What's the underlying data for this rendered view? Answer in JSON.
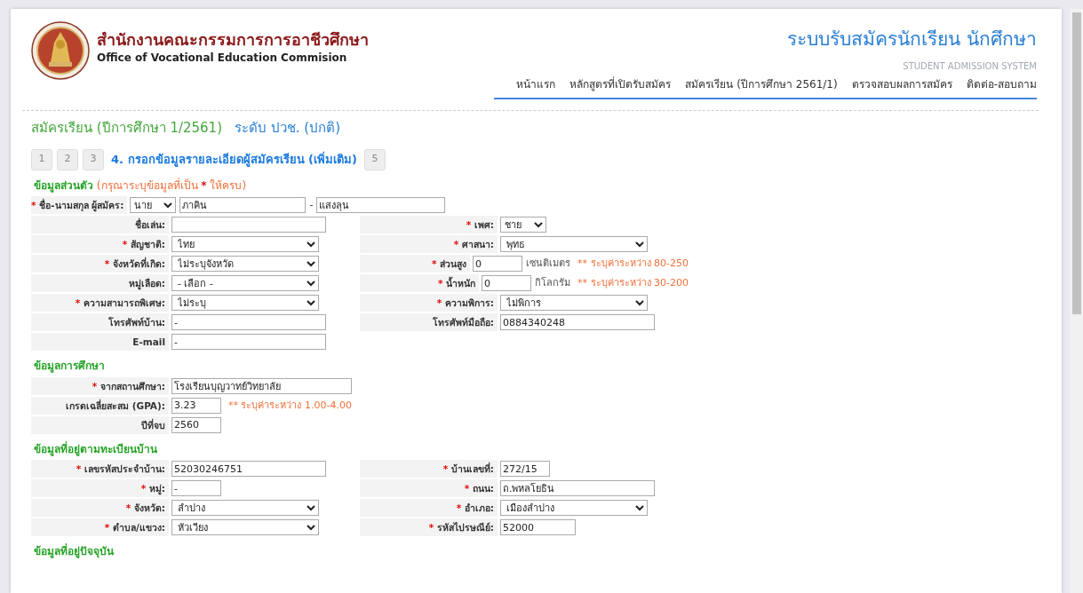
{
  "required_mark": "*",
  "header": {
    "title_th": "สำนักงานคณะกรรมการการอาชีวศึกษา",
    "title_en": "Office of Vocational Education Commision",
    "system_title": "ระบบรับสมัครนักเรียน นักศึกษา",
    "system_subtitle": "STUDENT ADMISSION SYSTEM"
  },
  "nav": [
    {
      "label": "หน้าแรก"
    },
    {
      "label": "หลักสูตรที่เปิดรับสมัคร"
    },
    {
      "label": "สมัครเรียน (ปีการศึกษา 2561/1)"
    },
    {
      "label": "ตรวจสอบผลการสมัคร"
    },
    {
      "label": "ติดต่อ-สอบถาม"
    }
  ],
  "page_title": {
    "main": "สมัครเรียน (ปีการศึกษา 1/2561)",
    "level": "ระดับ ปวช. (ปกติ)"
  },
  "steps": [
    {
      "label": "1",
      "selected": false
    },
    {
      "label": "2",
      "selected": false
    },
    {
      "label": "3",
      "selected": false
    },
    {
      "label": "4. กรอกข้อมูลรายละเอียดผู้สมัครเรียน (เพิ่มเติม)",
      "selected": true
    },
    {
      "label": "5",
      "selected": false
    }
  ],
  "sections": [
    {
      "title": "ข้อมูลส่วนตัว",
      "note": [
        "(กรุณาระบุข้อมูลที่เป็น",
        "ให้ครบ)"
      ],
      "rows": [
        {
          "left": {
            "label": "ชื่อ-นามสกุล ผู้สมัคร:",
            "required": true,
            "kind": "name",
            "title": "นาย",
            "first": "ภาคิน",
            "separator": "-",
            "last": "แสงลุน"
          }
        },
        {
          "left": {
            "label": "ชื่อเล่น:",
            "required": false,
            "kind": "text"
          },
          "right": {
            "label": "เพศ:",
            "required": true,
            "kind": "select-small",
            "value": "ชาย"
          }
        },
        {
          "left": {
            "label": "สัญชาติ:",
            "required": true,
            "kind": "select",
            "value": "ไทย"
          },
          "right": {
            "label": "ศาสนา:",
            "required": true,
            "kind": "select",
            "value": "พุทธ"
          }
        },
        {
          "left": {
            "label": "จังหวัดที่เกิด:",
            "required": true,
            "kind": "select",
            "value": "ไม่ระบุจังหวัด"
          },
          "right": {
            "label": "ส่วนสูง",
            "required": true,
            "kind": "short",
            "value": "0",
            "unit": "เซนติเมตร",
            "hint": "** ระบุค่าระหว่าง 80-250"
          }
        },
        {
          "left": {
            "label": "หมู่เลือด:",
            "required": false,
            "kind": "select",
            "value": "- เลือก -"
          },
          "right": {
            "label": "น้ำหนัก",
            "required": true,
            "kind": "short",
            "value": "0",
            "unit": "กิโลกรัม",
            "hint": "** ระบุค่าระหว่าง 30-200"
          }
        },
        {
          "left": {
            "label": "ความสามารถพิเศษ:",
            "required": true,
            "kind": "select",
            "value": "ไม่ระบุ"
          },
          "right": {
            "label": "ความพิการ:",
            "required": true,
            "kind": "select",
            "value": "ไม่พิการ"
          }
        },
        {
          "left": {
            "label": "โทรศัพท์บ้าน:",
            "required": false,
            "kind": "text",
            "value": "-"
          },
          "right": {
            "label": "โทรศัพท์มือถือ:",
            "required": false,
            "kind": "text",
            "value": "0884340248"
          }
        },
        {
          "left": {
            "label": "E-mail",
            "required": false,
            "kind": "text",
            "value": "-"
          }
        }
      ]
    },
    {
      "title": "ข้อมูลการศึกษา",
      "rows": [
        {
          "left": {
            "label": "จากสถานศึกษา:",
            "required": true,
            "kind": "text-wide",
            "value": "โรงเรียนบุญวาทย์วิทยาลัย"
          }
        },
        {
          "left": {
            "label": "เกรดเฉลี่ยสะสม (GPA):",
            "required": false,
            "kind": "short",
            "value": "3.23",
            "hint": "** ระบุค่าระหว่าง 1.00-4.00"
          }
        },
        {
          "left": {
            "label": "ปีที่จบ",
            "required": false,
            "kind": "short",
            "value": "2560"
          }
        }
      ]
    },
    {
      "title": "ข้อมูลที่อยู่ตามทะเบียนบ้าน",
      "rows": [
        {
          "left": {
            "label": "เลขรหัสประจำบ้าน:",
            "required": true,
            "kind": "text",
            "value": "52030246751"
          },
          "right": {
            "label": "บ้านเลขที่:",
            "required": true,
            "kind": "short",
            "value": "272/15"
          }
        },
        {
          "left": {
            "label": "หมู่:",
            "required": true,
            "kind": "short",
            "value": "-"
          },
          "right": {
            "label": "ถนน:",
            "required": true,
            "kind": "text",
            "value": "ถ.พหลโยธิน"
          }
        },
        {
          "left": {
            "label": "จังหวัด:",
            "required": true,
            "kind": "select",
            "value": "ลำปาง"
          },
          "right": {
            "label": "อำเภอ:",
            "required": true,
            "kind": "select",
            "value": "เมืองลำปาง"
          }
        },
        {
          "left": {
            "label": "ตำบล/แขวง:",
            "required": true,
            "kind": "select",
            "value": "หัวเวียง"
          },
          "right": {
            "label": "รหัสไปรษณีย์:",
            "required": true,
            "kind": "medium",
            "value": "52000"
          }
        }
      ]
    },
    {
      "title": "ข้อมูลที่อยู่ปัจจุบัน"
    }
  ]
}
